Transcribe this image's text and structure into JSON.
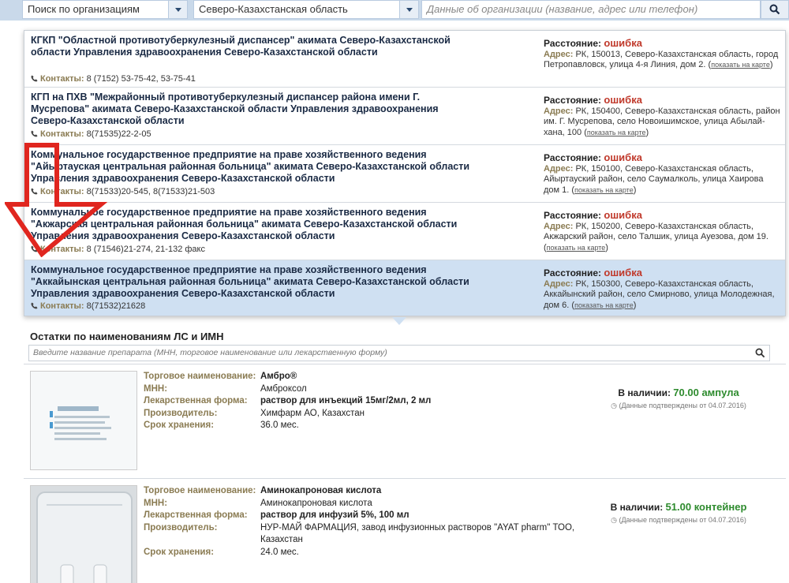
{
  "topbar": {
    "search_mode": "Поиск по организациям",
    "region": "Северо-Казахстанская область",
    "query_placeholder": "Данные об организации (название, адрес или телефон)"
  },
  "labels": {
    "contacts": "Контакты:",
    "distance": "Расстояние:",
    "distance_value": "ошибка",
    "address": "Адрес:",
    "map_link": "показать на карте"
  },
  "organizations": [
    {
      "name": "КГКП \"Областной противотуберкулезный диспансер\" акимата Северо-Казахстанской области Управления здравоохранения Северо-Казахстанской области",
      "contacts": "8 (7152) 53-75-42, 53-75-41",
      "address": "РК, 150013, Северо-Казахстанская область, город Петропавловск, улица 4-я Линия, дом 2."
    },
    {
      "name": "КГП на ПХВ \"Межрайонный противотуберкулезный диспансер района имени Г. Мусрепова\" акимата Северо-Казахстанской области Управления здравоохранения Северо-Казахстанской области",
      "contacts": "8(71535)22-2-05",
      "address": "РК, 150400, Северо-Казахстанская область, район им. Г. Мусрепова, село Новоишимское, улица Абылай-хана, 100"
    },
    {
      "name": "Коммунальное государственное предприятие на праве хозяйственного ведения \"Айыртауская центральная районная больница\" акимата Северо-Казахстанской области Управления здравоохранения Северо-Казахстанской области",
      "contacts": "8(71533)20-545, 8(71533)21-503",
      "address": "РК, 150100, Северо-Казахстанская область, Айыртауский район, село Саумалколь, улица Хаирова дом 1."
    },
    {
      "name": "Коммунальное государственное предприятие на праве хозяйственного ведения \"Акжарская центральная районная больница\" акимата Северо-Казахстанской области Управления здравоохранения Северо-Казахстанской области",
      "contacts": "8 (71546)21-274, 21-132 факс",
      "address": "РК, 150200, Северо-Казахстанская область, Акжарский район, село Талшик, улица Ауезова, дом 19."
    },
    {
      "name": "Коммунальное государственное предприятие на праве хозяйственного ведения \"Аккайынская центральная районная больница\" акимата Северо-Казахстанской области Управления здравоохранения Северо-Казахстанской области",
      "contacts": "8(71532)21628",
      "address": "РК, 150300, Северо-Казахстанская область, Аккайынский район, село Смирново, улица Молодежная, дом 6."
    }
  ],
  "remains": {
    "title": "Остатки по наименованиям ЛС и ИМН",
    "search_placeholder": "Введите название препарата (МНН, торговое наименование или лекарственную форму)"
  },
  "drug_labels": {
    "trade_name": "Торговое наименование:",
    "inn": "МНН:",
    "form": "Лекарственная форма:",
    "manufacturer": "Производитель:",
    "shelf_life": "Срок хранения:",
    "in_stock": "В наличии:",
    "confirmed": "(Данные подтверждены от 04.07.2016)"
  },
  "drugs": [
    {
      "trade_name": "Амбро®",
      "inn": "Амброксол",
      "form": "раствор для инъекций 15мг/2мл, 2 мл",
      "manufacturer": "Химфарм АО, Казахстан",
      "shelf_life": "36.0 мес.",
      "stock": "70.00 ампула"
    },
    {
      "trade_name": "Аминокапроновая кислота",
      "inn": "Аминокапроновая кислота",
      "form": "раствор для инфузий 5%, 100 мл",
      "manufacturer": "НУР-МАЙ ФАРМАЦИЯ, завод инфузионных растворов \"AYAT pharm\" ТОО, Казахстан",
      "shelf_life": "24.0 мес.",
      "stock": "51.00 контейнер"
    }
  ],
  "colors": {
    "accent_blue": "#cfe0f2",
    "error_red": "#c0392b",
    "stock_green": "#2e8b2e",
    "arrow_red": "#e0261f"
  }
}
